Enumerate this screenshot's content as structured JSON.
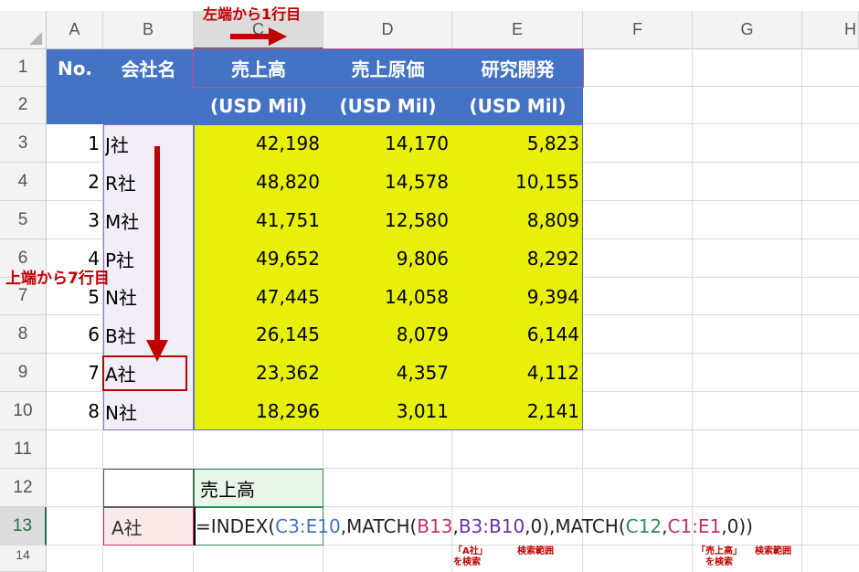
{
  "columns": [
    "A",
    "B",
    "C",
    "D",
    "E",
    "F",
    "G",
    "H"
  ],
  "rows": [
    "1",
    "2",
    "3",
    "4",
    "5",
    "6",
    "7",
    "8",
    "9",
    "10",
    "11",
    "12",
    "13",
    "14"
  ],
  "header": {
    "no": "No.",
    "company": "会社名",
    "sales": "売上高",
    "cogs": "売上原価",
    "rnd": "研究開発",
    "unit": "(USD Mil)"
  },
  "data_rows": [
    {
      "no": "1",
      "company": "J社",
      "sales": "42,198",
      "cogs": "14,170",
      "rnd": "5,823"
    },
    {
      "no": "2",
      "company": "R社",
      "sales": "48,820",
      "cogs": "14,578",
      "rnd": "10,155"
    },
    {
      "no": "3",
      "company": "M社",
      "sales": "41,751",
      "cogs": "12,580",
      "rnd": "8,809"
    },
    {
      "no": "4",
      "company": "P社",
      "sales": "49,652",
      "cogs": "9,806",
      "rnd": "8,292"
    },
    {
      "no": "5",
      "company": "N社",
      "sales": "47,445",
      "cogs": "14,058",
      "rnd": "9,394"
    },
    {
      "no": "6",
      "company": "B社",
      "sales": "26,145",
      "cogs": "8,079",
      "rnd": "6,144"
    },
    {
      "no": "7",
      "company": "A社",
      "sales": "23,362",
      "cogs": "4,357",
      "rnd": "4,112"
    },
    {
      "no": "8",
      "company": "N社",
      "sales": "18,296",
      "cogs": "3,011",
      "rnd": "2,141"
    }
  ],
  "lookup": {
    "c12": "売上高",
    "b13": "A社"
  },
  "formula": {
    "p1": "=INDEX(",
    "r1": "C3:E10",
    "p2": ",MATCH(",
    "r2": "B13",
    "p3": ",",
    "r3": "B3:B10",
    "p4": ",0),MATCH(",
    "r4": "C12",
    "p5": ",",
    "r5": "C1:E1",
    "p6": ",0))"
  },
  "annotations": {
    "left_end": "左端から1行目",
    "top_end": "上端から7行目",
    "note_a": "「A社」",
    "note_a2": "を検索",
    "note_range1": "検索範囲",
    "note_sales": "「売上高」",
    "note_sales2": "を検索",
    "note_range2": "検索範囲"
  },
  "colors": {
    "header_blue": "#4472c4",
    "highlight_yellow": "#e8f00a",
    "annotation_red": "#c00000",
    "ref_blue": "#4472c4",
    "ref_purple": "#7030a0",
    "ref_green": "#2e8b57",
    "ref_pink": "#c0306f"
  }
}
